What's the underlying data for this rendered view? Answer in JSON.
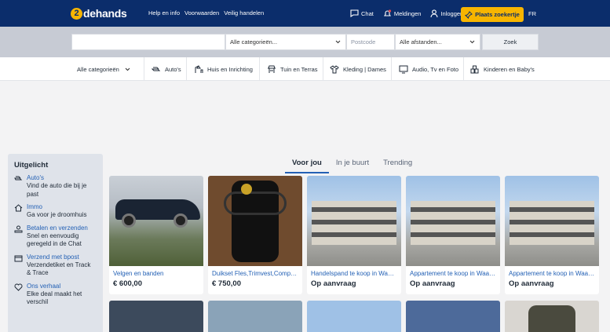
{
  "header": {
    "logo_mark": "2",
    "logo_text": "dehands",
    "nav": [
      "Help en info",
      "Voorwaarden",
      "Veilig handelen"
    ],
    "chat": "Chat",
    "notifications": "Meldingen",
    "login": "Inloggen",
    "place_ad": "Plaats zoekertje",
    "language": "FR"
  },
  "search": {
    "query": "",
    "category": "Alle categorieën...",
    "postcode_placeholder": "Postcode",
    "distance": "Alle afstanden...",
    "button": "Zoek"
  },
  "categories": [
    {
      "label": "Alle categorieën",
      "icon": "chevron-down-icon"
    },
    {
      "label": "Auto's",
      "icon": "car-icon"
    },
    {
      "label": "Huis en Inrichting",
      "icon": "lamp-icon"
    },
    {
      "label": "Tuin en Terras",
      "icon": "garden-icon"
    },
    {
      "label": "Kleding | Dames",
      "icon": "shirt-icon"
    },
    {
      "label": "Audio, Tv en Foto",
      "icon": "tv-icon"
    },
    {
      "label": "Kinderen en Baby's",
      "icon": "blocks-icon"
    }
  ],
  "sidebar": {
    "title": "Uitgelicht",
    "items": [
      {
        "link": "Auto's",
        "desc1": "Vind de auto die bij je",
        "desc2": "past",
        "desc3": "",
        "icon": "car-icon"
      },
      {
        "link": "Immo",
        "desc1": "Ga voor je droomhuis",
        "desc2": "",
        "desc3": "",
        "icon": "house-icon"
      },
      {
        "link": "Betalen en verzenden",
        "desc1": "Snel en eenvoudig",
        "desc2": "geregeld in de Chat",
        "desc3": "",
        "icon": "payment-icon"
      },
      {
        "link": "Verzend met bpost",
        "desc1": "Verzendetiket en Track",
        "desc2": "& Trace",
        "desc3": "",
        "icon": "shipping-icon"
      },
      {
        "link": "Ons verhaal",
        "desc1": "Elke deal maakt het",
        "desc2": "verschil",
        "desc3": "",
        "icon": "heart-icon"
      }
    ]
  },
  "tabs": [
    "Voor jou",
    "In je buurt",
    "Trending"
  ],
  "listings": [
    {
      "title": "Velgen en banden",
      "price": "€ 600,00"
    },
    {
      "title": "Duikset Fles,Trimvest,Computer,...",
      "price": "€ 750,00"
    },
    {
      "title": "Handelspand te koop in Waasmunster",
      "price": "Op aanvraag"
    },
    {
      "title": "Appartement te koop in Waasmunster",
      "price": "Op aanvraag"
    },
    {
      "title": "Appartement te koop in Waasmunster",
      "price": "Op aanvraag"
    }
  ],
  "colors": {
    "header": "#0b2d6b",
    "accent": "#f7b500",
    "link": "#2461b5"
  }
}
